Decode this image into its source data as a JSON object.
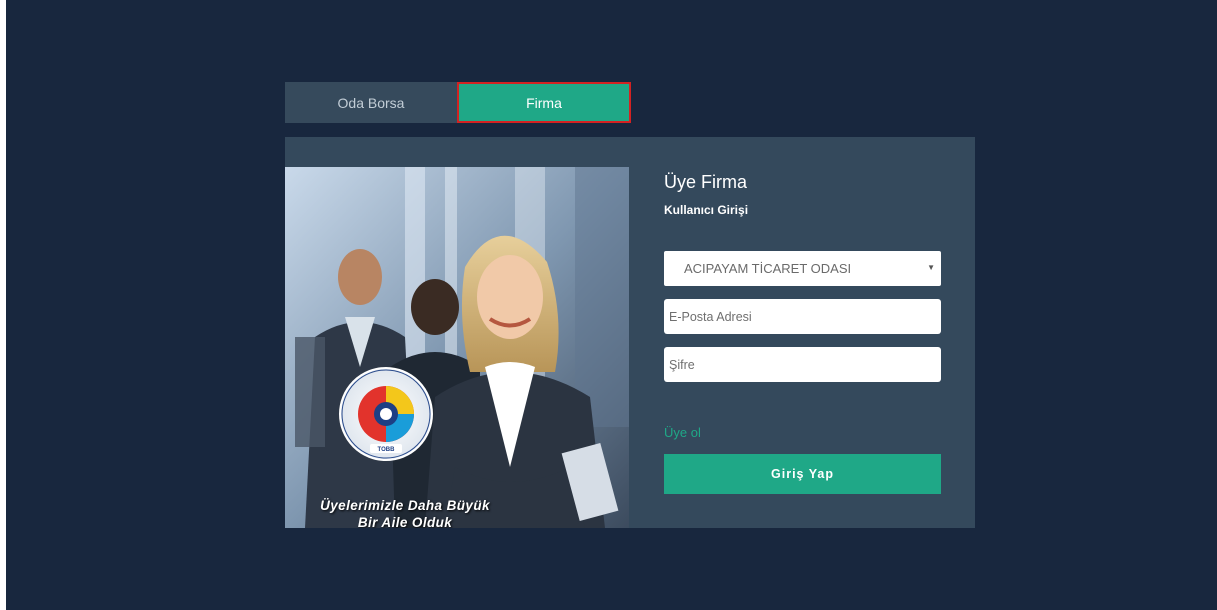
{
  "tabs": {
    "oda_borsa": "Oda Borsa",
    "firma": "Firma"
  },
  "photo": {
    "slogan_line1": "Üyelerimizle Daha Büyük",
    "slogan_line2": "Bir Aile Olduk",
    "logo_text_top": "TÜRKİYE ODALAR VE BORSALAR BİRLİĞİ",
    "logo_text_bottom": "TOBB"
  },
  "form": {
    "title": "Üye Firma",
    "subtitle": "Kullanıcı Girişi",
    "chamber_selected": "ACIPAYAM TİCARET ODASI",
    "email_placeholder": "E-Posta Adresi",
    "password_placeholder": "Şifre",
    "register_link": "Üye ol",
    "login_button": "Giriş Yap"
  },
  "colors": {
    "background": "#18273e",
    "card": "#34495c",
    "accent": "#1fa887",
    "tab_inactive": "#364a5c",
    "selected_outline": "#d32222"
  }
}
